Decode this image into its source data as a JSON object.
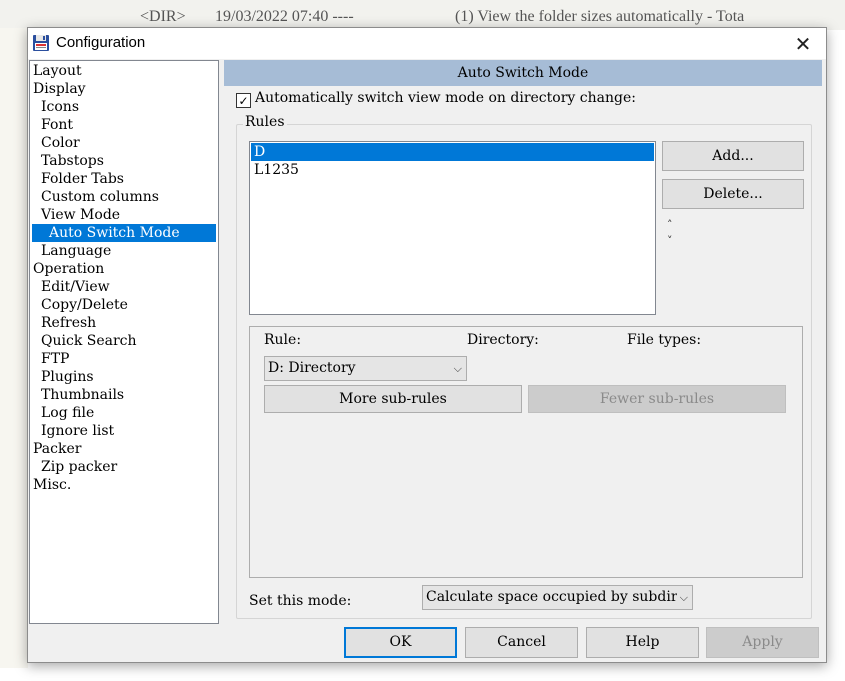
{
  "background": {
    "col1": "<DIR>",
    "col2": "19/03/2022 07:40 ----",
    "col3": "(1) View the folder sizes automatically - Tota"
  },
  "window": {
    "title": "Configuration",
    "close_glyph": "✕"
  },
  "tree": [
    {
      "label": "Layout",
      "level": 0
    },
    {
      "label": "Display",
      "level": 0
    },
    {
      "label": "Icons",
      "level": 1
    },
    {
      "label": "Font",
      "level": 1
    },
    {
      "label": "Color",
      "level": 1
    },
    {
      "label": "Tabstops",
      "level": 1
    },
    {
      "label": "Folder Tabs",
      "level": 1
    },
    {
      "label": "Custom columns",
      "level": 1
    },
    {
      "label": "View Mode",
      "level": 1
    },
    {
      "label": "Auto Switch Mode",
      "level": 2,
      "selected": true
    },
    {
      "label": "Language",
      "level": 1
    },
    {
      "label": "Operation",
      "level": 0
    },
    {
      "label": "Edit/View",
      "level": 1
    },
    {
      "label": "Copy/Delete",
      "level": 1
    },
    {
      "label": "Refresh",
      "level": 1
    },
    {
      "label": "Quick Search",
      "level": 1
    },
    {
      "label": "FTP",
      "level": 1
    },
    {
      "label": "Plugins",
      "level": 1
    },
    {
      "label": "Thumbnails",
      "level": 1
    },
    {
      "label": "Log file",
      "level": 1
    },
    {
      "label": "Ignore list",
      "level": 1
    },
    {
      "label": "Packer",
      "level": 0
    },
    {
      "label": "Zip packer",
      "level": 1
    },
    {
      "label": "Misc.",
      "level": 0
    }
  ],
  "panel": {
    "header": "Auto Switch Mode",
    "auto_switch": {
      "label": "Automatically switch view mode on directory change:",
      "checked": true,
      "check_glyph": "✓"
    },
    "rules_group": "Rules",
    "rules": [
      {
        "label": "D",
        "selected": true
      },
      {
        "label": "L1235",
        "selected": false
      }
    ],
    "add_label": "Add...",
    "delete_label": "Delete...",
    "up_glyph": "˄",
    "down_glyph": "˅",
    "rule_label": "Rule:",
    "directory_label": "Directory:",
    "filetypes_label": "File types:",
    "rule_select": "D: Directory",
    "more_subrules": "More sub-rules",
    "fewer_subrules": "Fewer sub-rules",
    "set_mode_label": "Set this mode:",
    "mode_select": "Calculate space occupied by subdir",
    "chevron_glyph": "⌵"
  },
  "footer": {
    "ok": "OK",
    "cancel": "Cancel",
    "help": "Help",
    "apply": "Apply"
  },
  "colors": {
    "selection": "#0078d7",
    "header_band": "#a6bcd6"
  }
}
